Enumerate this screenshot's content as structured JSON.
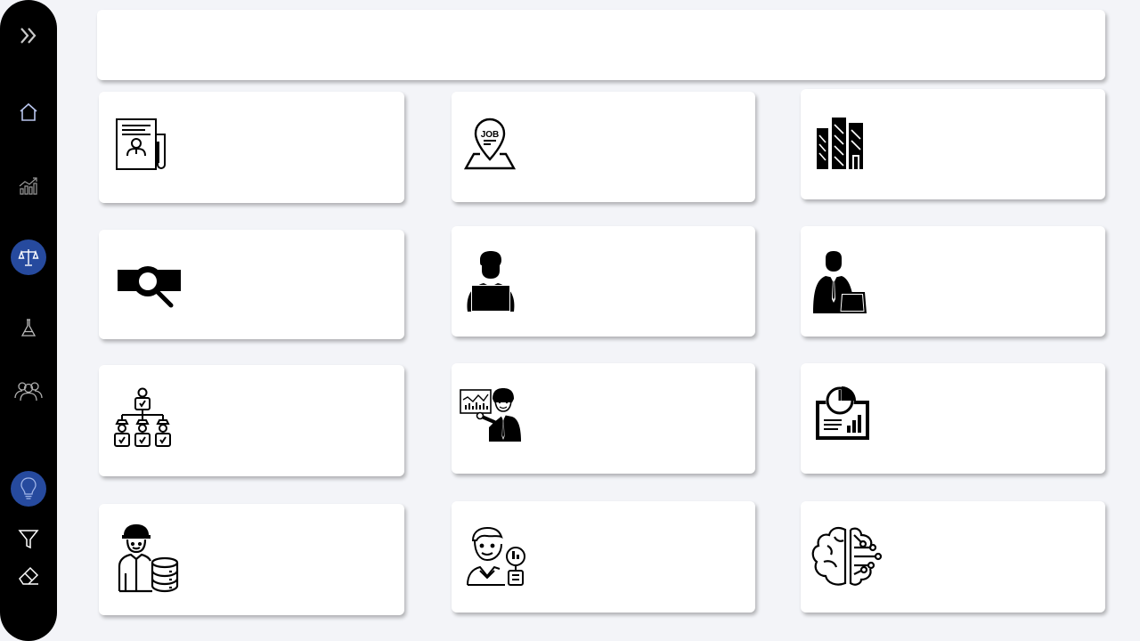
{
  "sidebar": {
    "items": [
      {
        "icon": "expand-chevrons-icon"
      },
      {
        "icon": "home-icon"
      },
      {
        "icon": "growth-chart-icon"
      },
      {
        "icon": "balance-scale-icon",
        "active": true
      },
      {
        "icon": "flask-icon"
      },
      {
        "icon": "people-group-icon"
      },
      {
        "icon": "lightbulb-icon",
        "active": true
      },
      {
        "icon": "filter-icon"
      },
      {
        "icon": "eraser-icon"
      }
    ]
  },
  "header": {
    "title": ""
  },
  "tiles": [
    {
      "icon": "resume-document-icon"
    },
    {
      "icon": "job-location-pin-icon",
      "text": "JOB"
    },
    {
      "icon": "office-buildings-icon"
    },
    {
      "icon": "search-magnifier-icon"
    },
    {
      "icon": "person-laptop-icon"
    },
    {
      "icon": "businessman-laptop-icon"
    },
    {
      "icon": "org-hierarchy-icon"
    },
    {
      "icon": "presenter-chart-icon"
    },
    {
      "icon": "report-pie-bar-icon"
    },
    {
      "icon": "engineer-database-icon"
    },
    {
      "icon": "analyst-magnifier-icon"
    },
    {
      "icon": "ai-brain-circuit-icon"
    }
  ],
  "colors": {
    "background": "#f3f4f8",
    "sidebar": "#000000",
    "active_circle": "#264a9e",
    "card": "#ffffff"
  }
}
